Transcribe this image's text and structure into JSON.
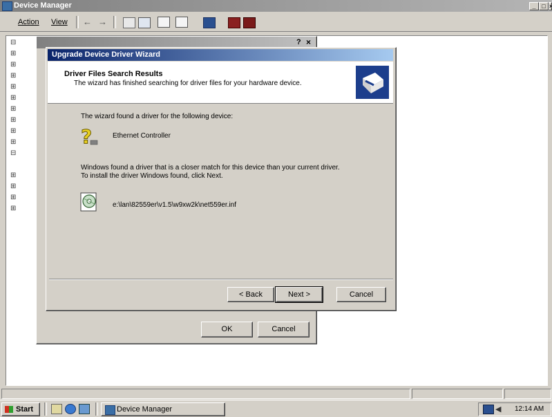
{
  "main_window": {
    "title": "Device Manager",
    "menu": {
      "action": "Action",
      "view": "View"
    }
  },
  "properties_dialog": {
    "ok_label": "OK",
    "cancel_label": "Cancel",
    "help_glyph": "?",
    "close_glyph": "×"
  },
  "wizard": {
    "title": "Upgrade Device Driver Wizard",
    "header_title": "Driver Files Search Results",
    "header_subtitle": "The wizard has finished searching for driver files for your hardware device.",
    "found_text": "The wizard found a driver for the following device:",
    "device_name": "Ethernet Controller",
    "closer_match_line1": "Windows found a driver that is a closer match for this device than your current driver.",
    "closer_match_line2": "To install the driver Windows found, click Next.",
    "driver_path": "e:\\lan\\82559er\\v1.5\\w9xw2k\\net559er.inf",
    "back_label": "< Back",
    "next_label": "Next >",
    "cancel_label": "Cancel"
  },
  "taskbar": {
    "start_label": "Start",
    "task_label": "Device Manager",
    "clock": "12:14 AM"
  },
  "window_controls": {
    "minimize": "_",
    "maximize": "□",
    "close": "×"
  },
  "colors": {
    "titlebar_active": "#0a246a",
    "titlebar_gradient_end": "#a6caf0",
    "titlebar_inactive": "#808080",
    "face": "#d4d0c8"
  }
}
